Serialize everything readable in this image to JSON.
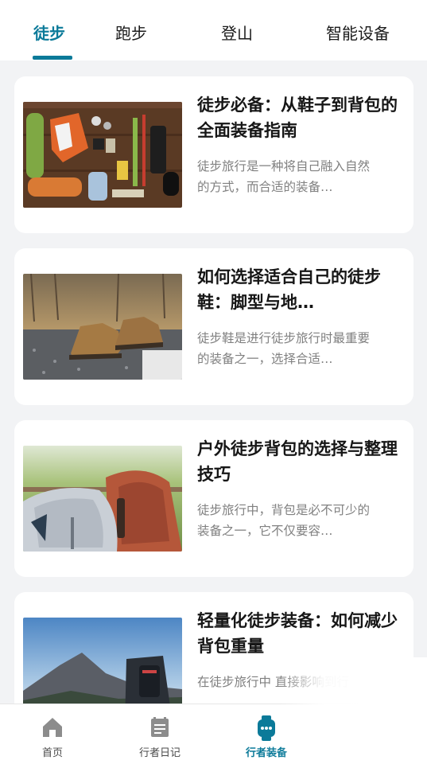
{
  "tabs": [
    {
      "label": "徒步",
      "active": true
    },
    {
      "label": "跑步",
      "active": false
    },
    {
      "label": "登山",
      "active": false
    },
    {
      "label": "智能设备",
      "active": false
    }
  ],
  "colors": {
    "accent": "#0b7a99",
    "background": "#f2f3f5",
    "card": "#ffffff"
  },
  "articles": [
    {
      "title": "徒步必备：从鞋子到背包的全面装备指南",
      "desc": "徒步旅行是一种将自己融入自然的方式，而合适的装备…",
      "image": "hiking-gear-flatlay"
    },
    {
      "title": "如何选择适合自己的徒步鞋：脚型与地…",
      "desc": "徒步鞋是进行徒步旅行时最重要的装备之一，选择合适…",
      "image": "hiking-boots-on-gravel"
    },
    {
      "title": "户外徒步背包的选择与整理技巧",
      "desc": "徒步旅行中，背包是必不可少的装备之一，它不仅要容…",
      "image": "two-backpacks-outdoors"
    },
    {
      "title": "轻量化徒步装备：如何减少背包重量",
      "desc": "在徒步旅行中 直接影响到行",
      "image": "backpack-mountain-view"
    }
  ],
  "bottom_nav": [
    {
      "label": "首页",
      "icon": "home-icon",
      "active": false
    },
    {
      "label": "行者日记",
      "icon": "diary-icon",
      "active": false
    },
    {
      "label": "行者装备",
      "icon": "smartwatch-icon",
      "active": true
    }
  ]
}
